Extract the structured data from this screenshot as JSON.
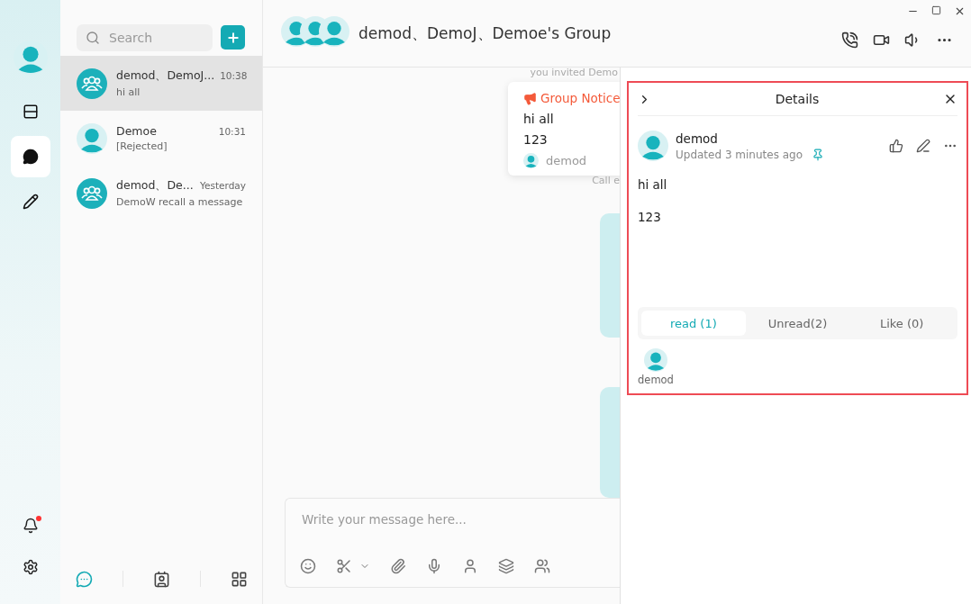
{
  "rail": {
    "items": [
      {
        "kind": "list",
        "selected": false
      },
      {
        "kind": "chat",
        "selected": true
      },
      {
        "kind": "pencil",
        "selected": false
      }
    ],
    "bell": {
      "badge": true
    }
  },
  "search": {
    "placeholder": "Search"
  },
  "conversations": [
    {
      "kind": "group",
      "title": "demod、DemoJ...",
      "time": "10:38",
      "preview": "hi all",
      "selected": true
    },
    {
      "kind": "person",
      "title": "Demoe",
      "time": "10:31",
      "preview": "[Rejected]",
      "selected": false
    },
    {
      "kind": "group",
      "title": "demod、De...",
      "time": "Yesterday",
      "preview": "DemoW recall a message",
      "selected": false
    }
  ],
  "bottom_tabs": [
    {
      "kind": "chats",
      "selected": true
    },
    {
      "kind": "contacts",
      "selected": false
    },
    {
      "kind": "apps",
      "selected": false
    }
  ],
  "chat": {
    "title": "demod、DemoJ、Demoe's Group",
    "messages": [
      {
        "kind": "system",
        "text": "you invited Demo"
      },
      {
        "kind": "notice",
        "label": "Group Notice",
        "lines": [
          "hi all",
          "123"
        ],
        "author": "demod"
      },
      {
        "kind": "system",
        "text": "Call e"
      },
      {
        "kind": "bubble"
      },
      {
        "kind": "bubble"
      }
    ],
    "composer": {
      "placeholder": "Write your message here..."
    }
  },
  "details": {
    "title": "Details",
    "author": "demod",
    "updated": "Updated 3 minutes ago",
    "pinned": true,
    "body": [
      "hi all",
      "123"
    ],
    "tabs": [
      {
        "label": "read (1)",
        "selected": true
      },
      {
        "label": "Unread(2)",
        "selected": false
      },
      {
        "label": "Like (0)",
        "selected": false
      }
    ],
    "readers": [
      {
        "name": "demod"
      }
    ]
  }
}
